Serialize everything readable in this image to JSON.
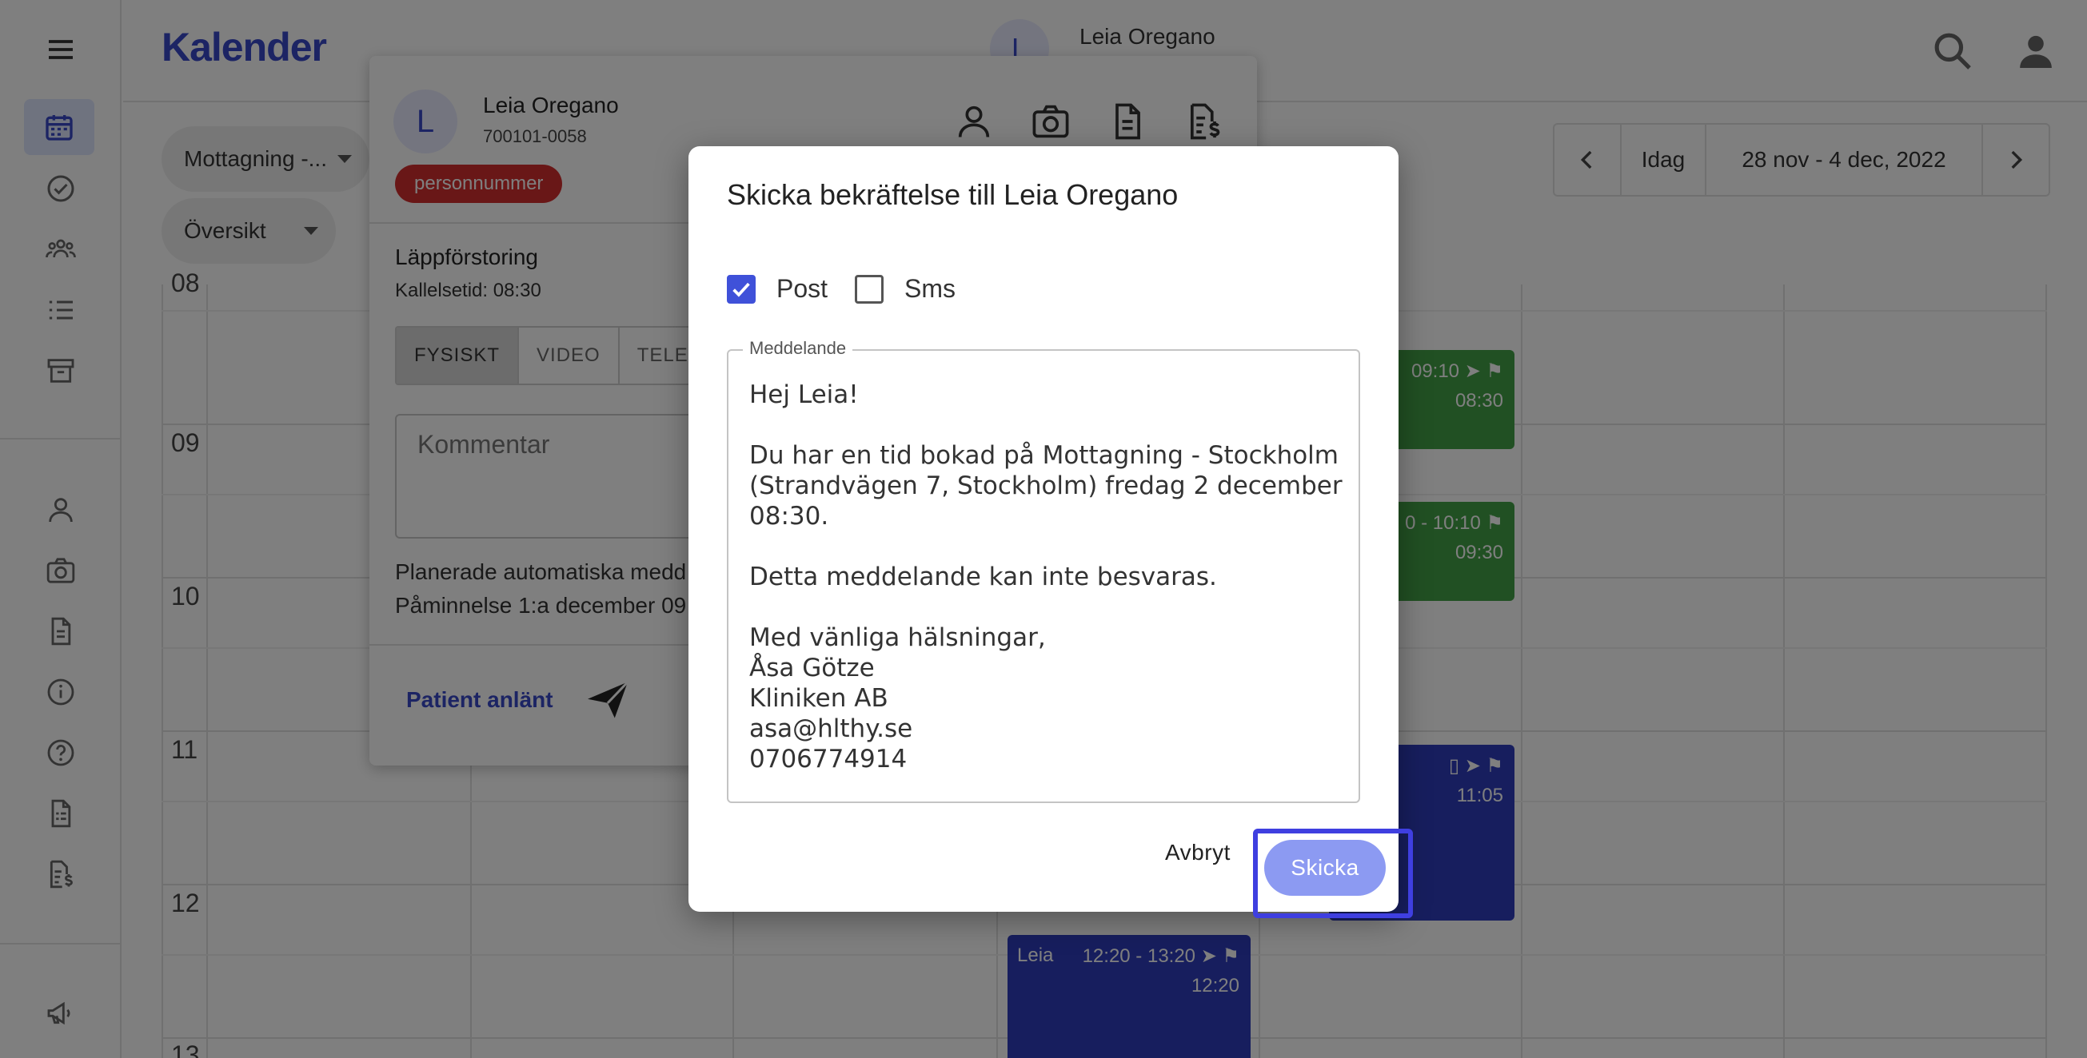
{
  "app": {
    "title": "Kalender"
  },
  "topbar": {
    "user_initial": "L",
    "user_name": "Leia Oregano"
  },
  "filters": {
    "clinic": "Mottagning -...",
    "view": "Översikt"
  },
  "week_nav": {
    "today": "Idag",
    "range": "28 nov - 4 dec, 2022"
  },
  "calendar": {
    "hours": [
      "08",
      "09",
      "10",
      "11",
      "12",
      "13"
    ],
    "events": [
      {
        "time": "09:10",
        "start": "08:30",
        "color": "#43a047"
      },
      {
        "time": "0 - 10:10",
        "start": "09:30",
        "color": "#43a047"
      },
      {
        "time": "11:05",
        "color": "#2e3dbd"
      },
      {
        "name": "Leia",
        "time": "12:20 - 13:20",
        "start": "12:20",
        "color": "#2e3dbd"
      }
    ]
  },
  "patient_popover": {
    "initial": "L",
    "name": "Leia Oregano",
    "personal_number": "700101-0058",
    "badge": "personnummer",
    "reason": "Läppförstoring",
    "call_time": "Kallelsetid: 08:30",
    "tabs": [
      "FYSISKT",
      "VIDEO",
      "TELEFON"
    ],
    "comment_placeholder": "Kommentar",
    "planned_messages": "Planerade automatiska medd",
    "reminder": "Påminnelse 1:a december 09",
    "arrived_button": "Patient anlänt"
  },
  "dialog": {
    "title": "Skicka bekräftelse till Leia Oregano",
    "options": [
      {
        "label": "Post",
        "checked": true
      },
      {
        "label": "Sms",
        "checked": false
      }
    ],
    "message_label": "Meddelande",
    "message_lines": [
      "Hej Leia!",
      "",
      "Du har en tid bokad på Mottagning - Stockholm",
      "(Strandvägen 7, Stockholm) fredag 2 december",
      "08:30.",
      "",
      "Detta meddelande kan inte besvaras.",
      "",
      "Med vänliga hälsningar,",
      "Åsa Götze",
      "Kliniken AB",
      "asa@hlthy.se",
      "0706774914"
    ],
    "cancel_label": "Avbryt",
    "send_label": "Skicka"
  },
  "colors": {
    "brand": "#3949c8",
    "checkbox": "#3f51d9",
    "send_button": "#8c9af2",
    "focus_ring": "#3f3fe0"
  }
}
